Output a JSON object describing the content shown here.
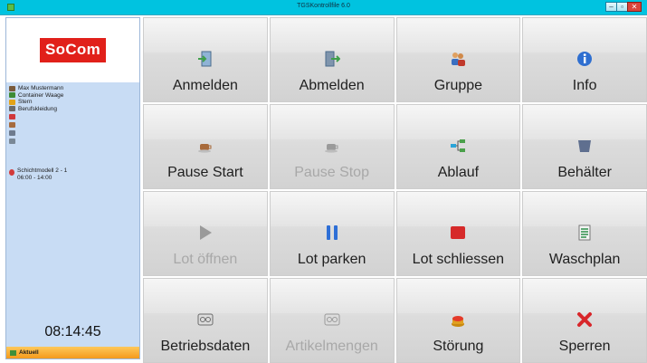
{
  "window": {
    "title": "TGSKontrollfile 6.0",
    "controls": [
      "–",
      "▫",
      "✕"
    ]
  },
  "sidebar": {
    "logo_text": "SoCom",
    "info": [
      {
        "text": "Max Mustermann",
        "icon": "person-icon",
        "color": "#7a5a3a"
      },
      {
        "text": "Container Waage",
        "icon": "container-icon",
        "color": "#3e8b34"
      },
      {
        "text": "Stern",
        "icon": "person-yellow-icon",
        "color": "#e3a318"
      },
      {
        "text": "Berufskleidung",
        "icon": "clothing-icon",
        "color": "#6b6b6b"
      },
      {
        "text": "",
        "icon": "flag-icon",
        "color": "#d0383c"
      },
      {
        "text": "",
        "icon": "coffee-icon",
        "color": "#a66b3e"
      },
      {
        "text": "",
        "icon": "gear-icon",
        "color": "#6e7b8e"
      },
      {
        "text": "",
        "icon": "tool-icon",
        "color": "#7a8896"
      }
    ],
    "shift": {
      "name": "Schichtmodell 2 - 1",
      "time": "06:00 - 14:00"
    },
    "clock": "08:14:45",
    "status": "Aktuell"
  },
  "buttons": [
    {
      "label": "Anmelden",
      "icon": "login-icon",
      "enabled": true,
      "color": "#3f9f4a"
    },
    {
      "label": "Abmelden",
      "icon": "logout-icon",
      "enabled": true,
      "color": "#3f9f4a"
    },
    {
      "label": "Gruppe",
      "icon": "group-icon",
      "enabled": true,
      "color": "#3a6fc1"
    },
    {
      "label": "Info",
      "icon": "info-icon",
      "enabled": true,
      "color": "#2f6fd0"
    },
    {
      "label": "Pause Start",
      "icon": "coffee-icon",
      "enabled": true,
      "color": "#a86a3a"
    },
    {
      "label": "Pause Stop",
      "icon": "coffee-stop-icon",
      "enabled": false,
      "color": "#9a9a9a"
    },
    {
      "label": "Ablauf",
      "icon": "flow-icon",
      "enabled": true,
      "color": "#2aa4d8"
    },
    {
      "label": "Behälter",
      "icon": "container-icon",
      "enabled": true,
      "color": "#5f6f8f"
    },
    {
      "label": "Lot öffnen",
      "icon": "play-icon",
      "enabled": false,
      "color": "#9a9a9a"
    },
    {
      "label": "Lot parken",
      "icon": "pause-icon",
      "enabled": true,
      "color": "#2e6fd6"
    },
    {
      "label": "Lot schliessen",
      "icon": "stop-icon",
      "enabled": true,
      "color": "#d62a2a"
    },
    {
      "label": "Waschplan",
      "icon": "document-icon",
      "enabled": true,
      "color": "#2d8f4a"
    },
    {
      "label": "Betriebsdaten",
      "icon": "gauge-icon",
      "enabled": true,
      "color": "#6c6c6c"
    },
    {
      "label": "Artikelmengen",
      "icon": "counter-icon",
      "enabled": false,
      "color": "#9a9a9a"
    },
    {
      "label": "Störung",
      "icon": "alarm-icon",
      "enabled": true,
      "color": "#e0a020"
    },
    {
      "label": "Sperren",
      "icon": "cross-icon",
      "enabled": true,
      "color": "#d8262a"
    }
  ]
}
